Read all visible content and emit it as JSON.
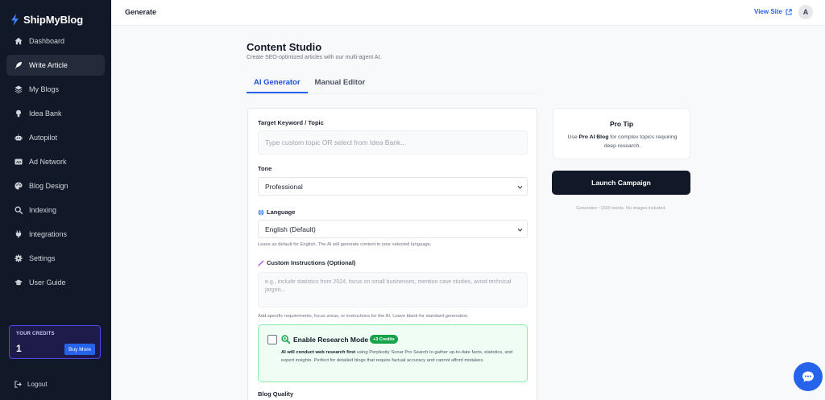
{
  "app": {
    "name": "ShipMyBlog",
    "brand_color": "#2563eb"
  },
  "sidebar": {
    "items": [
      {
        "label": "Dashboard",
        "icon": "home-icon"
      },
      {
        "label": "Write Article",
        "icon": "feather-icon",
        "active": true
      },
      {
        "label": "My Blogs",
        "icon": "layers-icon"
      },
      {
        "label": "Idea Bank",
        "icon": "lightbulb-icon"
      },
      {
        "label": "Autopilot",
        "icon": "robot-icon"
      },
      {
        "label": "Ad Network",
        "icon": "ad-icon"
      },
      {
        "label": "Blog Design",
        "icon": "palette-icon"
      },
      {
        "label": "Indexing",
        "icon": "search-icon"
      },
      {
        "label": "Integrations",
        "icon": "plug-icon"
      },
      {
        "label": "Settings",
        "icon": "gear-icon"
      },
      {
        "label": "User Guide",
        "icon": "graduation-cap-icon"
      }
    ],
    "credits": {
      "label": "YOUR CREDITS",
      "value": "1",
      "buy_label": "Buy More"
    },
    "logout_label": "Logout"
  },
  "topbar": {
    "title": "Generate",
    "view_site": "View Site",
    "avatar_initial": "A"
  },
  "main": {
    "title": "Content Studio",
    "subtitle": "Create SEO-optimized articles with our multi-agent AI.",
    "tabs": [
      {
        "label": "AI Generator",
        "active": true
      },
      {
        "label": "Manual Editor"
      }
    ],
    "form": {
      "keyword_label": "Target Keyword / Topic",
      "keyword_placeholder": "Type custom topic OR select from Idea Bank...",
      "tone_label": "Tone",
      "tone_value": "Professional",
      "language_label": "Language",
      "language_value": "English (Default)",
      "language_help": "Leave as default for English. The AI will generate content in your selected language.",
      "instructions_label": "Custom Instructions (Optional)",
      "instructions_placeholder": "e.g., include statistics from 2024, focus on small businesses, mention case studies, avoid technical jargon...",
      "instructions_help": "Add specific requirements, focus areas, or instructions for the AI. Leave blank for standard generation.",
      "research": {
        "title": "Enable Research Mode",
        "badge": "+3 Credits",
        "desc_bold": "AI will conduct web research first",
        "desc_rest": " using Perplexity Sonar Pro Search to gather up-to-date facts, statistics, and expert insights. Perfect for detailed blogs that require factual accuracy and cannot afford mistakes."
      },
      "quality_label": "Blog Quality"
    },
    "tip": {
      "title": "Pro Tip",
      "pre": "Use ",
      "bold": "Pro AI Blog",
      "post": " for complex topics requiring deep research."
    },
    "launch_label": "Launch Campaign",
    "launch_note": "Generates ~1500 words. No images included."
  }
}
